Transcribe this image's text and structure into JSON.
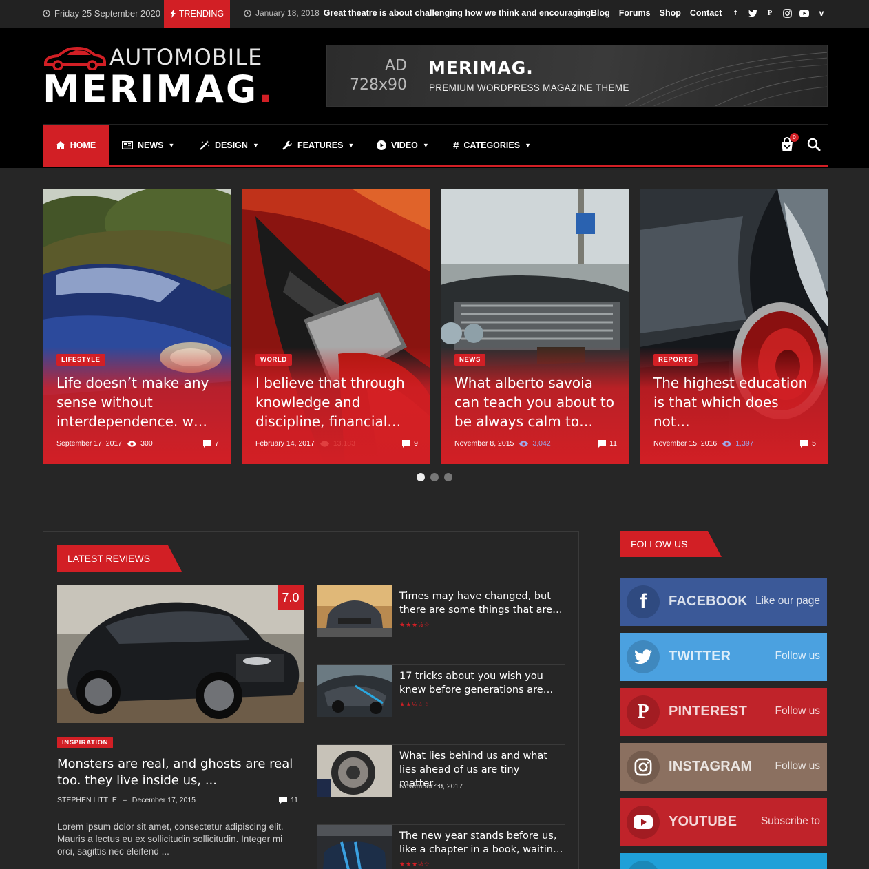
{
  "topbar": {
    "date": "Friday 25 September 2020",
    "trending_label": "TRENDING",
    "trending_date": "January 18, 2018",
    "trending_title": "Great theatre is about challenging how we think and encouraging",
    "links": [
      "Blog",
      "Forums",
      "Shop",
      "Contact"
    ],
    "social_icons": [
      "facebook-icon",
      "twitter-icon",
      "pinterest-icon",
      "instagram-icon",
      "youtube-icon",
      "vimeo-icon"
    ]
  },
  "header": {
    "logo_top": "AUTOMOBILE",
    "logo_main": "MERIMAG",
    "logo_dot": ".",
    "ad_label_line1": "AD",
    "ad_label_line2": "728x90",
    "ad_title": "MERIMAG.",
    "ad_subtitle": "PREMIUM WORDPRESS MAGAZINE THEME"
  },
  "nav": {
    "items": [
      {
        "label": "HOME",
        "icon": "home-icon"
      },
      {
        "label": "NEWS",
        "icon": "newspaper-icon"
      },
      {
        "label": "DESIGN",
        "icon": "magic-wand-icon"
      },
      {
        "label": "FEATURES",
        "icon": "wrench-icon"
      },
      {
        "label": "VIDEO",
        "icon": "play-circle-icon"
      },
      {
        "label": "CATEGORIES",
        "icon": "hashtag-icon"
      }
    ],
    "cart_count": "0"
  },
  "slider": {
    "cards": [
      {
        "category": "LIFESTYLE",
        "title": "Life doesn’t make any sense without interdependence. w…",
        "date": "September 17, 2017",
        "views": "300",
        "comments": "7"
      },
      {
        "category": "WORLD",
        "title": "I believe that through knowledge and discipline, financial…",
        "date": "February 14, 2017",
        "views": "13,183",
        "comments": "9"
      },
      {
        "category": "NEWS",
        "title": "What alberto savoia can teach you about to be always calm to…",
        "date": "November 8, 2015",
        "views": "3,042",
        "comments": "11"
      },
      {
        "category": "REPORTS",
        "title": "The highest education is that which does not…",
        "date": "November 15, 2016",
        "views": "1,397",
        "comments": "5"
      }
    ]
  },
  "reviews": {
    "heading": "LATEST REVIEWS",
    "main": {
      "score": "7.0",
      "category": "INSPIRATION",
      "title": "Monsters are real, and ghosts are real too. they live inside us, ...",
      "author": "STEPHEN LITTLE",
      "separator": "–",
      "date": "December 17, 2015",
      "comments": "11",
      "excerpt": "Lorem ipsum dolor sit amet, consectetur adipiscing elit. Mauris a lectus eu ex sollicitudin sollicitudin. Integer mi orci, sagittis nec eleifend ..."
    },
    "list": [
      {
        "title": "Times may have changed, but there are some things that are…",
        "rating": 3.5
      },
      {
        "title": "17 tricks about you wish you knew before generations are…",
        "rating": 2.5
      },
      {
        "title": "What lies behind us and what lies ahead of us are tiny matter…",
        "date": "November 10, 2017"
      },
      {
        "title": "The new year stands before us, like a chapter in a book, waitin…",
        "rating": 3.5
      }
    ]
  },
  "follow": {
    "heading": "FOLLOW US",
    "buttons": [
      {
        "name": "FACEBOOK",
        "action": "Like our page",
        "color": "#3b5998",
        "icon": "facebook-icon"
      },
      {
        "name": "TWITTER",
        "action": "Follow us",
        "color": "#4ba1e0",
        "icon": "twitter-icon"
      },
      {
        "name": "PINTEREST",
        "action": "Follow us",
        "color": "#c0232a",
        "icon": "pinterest-icon"
      },
      {
        "name": "INSTAGRAM",
        "action": "Follow us",
        "color": "#8b7060",
        "icon": "instagram-icon"
      },
      {
        "name": "YOUTUBE",
        "action": "Subscribe to",
        "color": "#c0232a",
        "icon": "youtube-icon"
      },
      {
        "color": "#1fa0d8"
      }
    ]
  },
  "colors": {
    "accent": "#d21f25",
    "background": "#262626",
    "header": "#000000"
  }
}
